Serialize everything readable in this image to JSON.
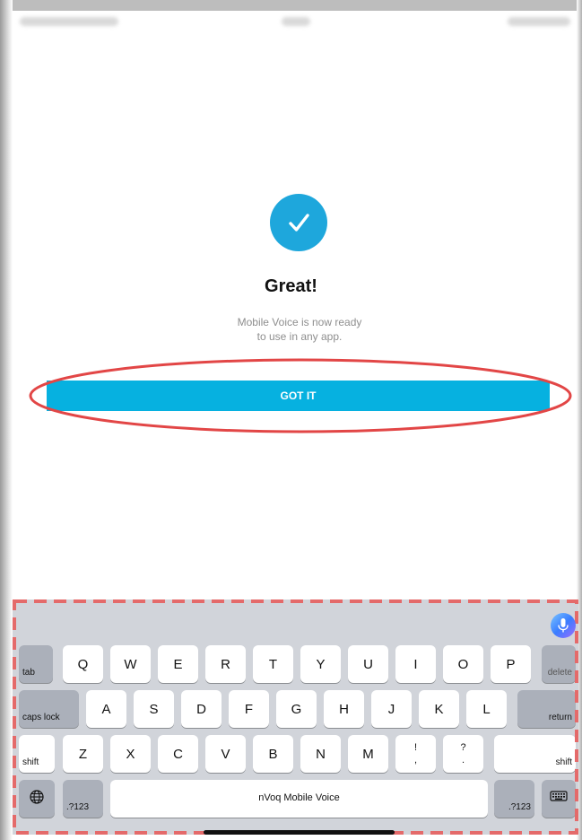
{
  "success": {
    "title": "Great!",
    "message_line1": "Mobile Voice is now ready",
    "message_line2": "to use in any app.",
    "button_label": "GOT IT"
  },
  "colors": {
    "accent": "#06b1e0",
    "annotation": "#e24646",
    "keyboard_bg": "#d1d4da"
  },
  "keyboard": {
    "row1": [
      "Q",
      "W",
      "E",
      "R",
      "T",
      "Y",
      "U",
      "I",
      "O",
      "P"
    ],
    "row2": [
      "A",
      "S",
      "D",
      "F",
      "G",
      "H",
      "J",
      "K",
      "L"
    ],
    "row3": [
      "Z",
      "X",
      "C",
      "V",
      "B",
      "N",
      "M"
    ],
    "tab": "tab",
    "delete": "delete",
    "caps_lock": "caps lock",
    "return": "return",
    "shift_left": "shift",
    "shift_right": "shift",
    "punct1_top": "!",
    "punct1_bottom": ",",
    "punct2_top": "?",
    "punct2_bottom": ".",
    "numbers_left": ".?123",
    "numbers_right": ".?123",
    "space_label": "nVoq Mobile Voice",
    "icons": [
      "globe-icon",
      "keyboard-hide-icon",
      "microphone-icon"
    ]
  }
}
